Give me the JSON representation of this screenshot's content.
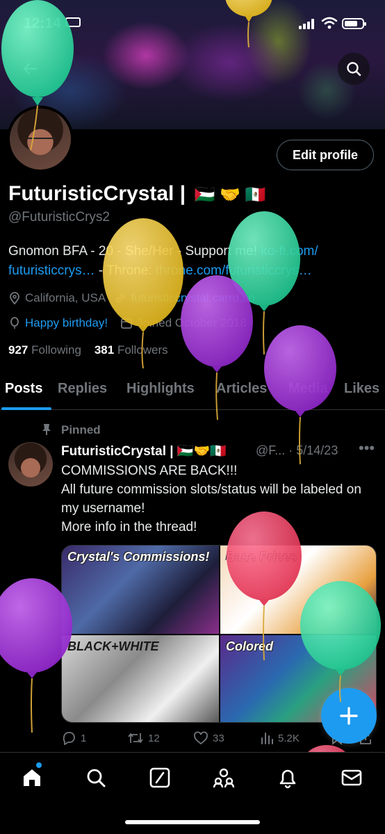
{
  "status_bar": {
    "time": "12:14"
  },
  "profile": {
    "display_name": "FuturisticCrystal |",
    "name_emojis": "🇵🇸 🤝 🇲🇽",
    "handle": "@FuturisticCrys2",
    "bio_prefix": "Gnomon BFA - 20 - She/Her - Support me! ",
    "bio_link1": "ko-fi.com/ futuristiccrys…",
    "bio_mid": " - Throne: ",
    "bio_link2": "throne.com/futuristiccrys…",
    "location": "California, USA",
    "website": "futuristiccrystal.carrd.co",
    "birthday": "Happy birthday!",
    "joined": "Joined October 2018",
    "following_count": "927",
    "following_label": "Following",
    "followers_count": "381",
    "followers_label": "Followers",
    "edit_profile_label": "Edit profile"
  },
  "tabs": [
    "Posts",
    "Replies",
    "Highlights",
    "Articles",
    "Media",
    "Likes"
  ],
  "tweet": {
    "pinned_label": "Pinned",
    "author": "FuturisticCrystal |",
    "author_emojis": "🇵🇸🤝🇲🇽",
    "handle_date": "@F... · 5/14/23",
    "text_lines": [
      "COMMISSIONS ARE BACK!!!",
      "All future commission slots/status will be labeled on my username!",
      "More info in the thread!"
    ],
    "media_labels": [
      "Crystal's Commissions!",
      "Base Prices",
      "BLACK+WHITE",
      "Colored"
    ],
    "replies": "1",
    "retweets": "12",
    "likes": "33",
    "views": "5.2K"
  },
  "colors": {
    "accent": "#1d9bf0",
    "muted": "#71767b",
    "background": "#000000"
  },
  "icons": [
    "back-arrow-icon",
    "search-icon",
    "location-icon",
    "link-icon",
    "balloon-icon",
    "calendar-icon",
    "pin-icon",
    "reply-icon",
    "retweet-icon",
    "like-icon",
    "views-icon",
    "bookmark-icon",
    "share-icon",
    "home-icon",
    "explore-icon",
    "grok-icon",
    "communities-icon",
    "notifications-icon",
    "messages-icon",
    "compose-icon"
  ]
}
